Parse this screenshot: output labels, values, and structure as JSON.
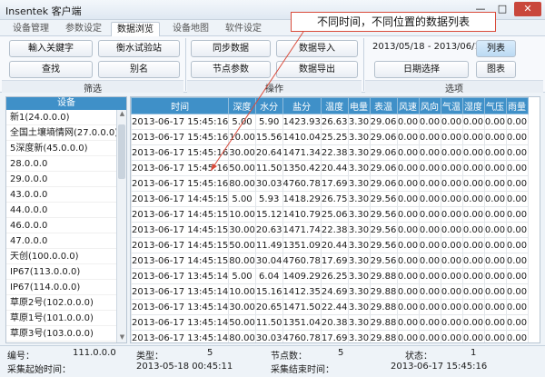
{
  "window": {
    "title": "Insentek 客户端",
    "min": "—",
    "max": "□",
    "close": "✕"
  },
  "tabs": [
    "设备管理",
    "参数设定",
    "数据浏览",
    "设备地图",
    "软件设定"
  ],
  "ribbon": {
    "filter": {
      "keyword_input": "輸入关鍵字",
      "site": "衡水试验站",
      "search": "查找",
      "alias": "别名",
      "label": "筛选"
    },
    "ops": {
      "sync": "同步数据",
      "import": "数据导入",
      "node_params": "节点参数",
      "export": "数据导出",
      "label": "操作"
    },
    "options": {
      "date_range": "2013/05/18 - 2013/06/17",
      "list": "列表",
      "date_select": "日期选择",
      "chart": "图表",
      "label": "选项"
    }
  },
  "device_panel": {
    "header": "设备",
    "items": [
      "新1(24.0.0.0)",
      "全国土壤墒情网(27.0.0.0)",
      "5深度新(45.0.0.0)",
      "28.0.0.0",
      "29.0.0.0",
      "43.0.0.0",
      "44.0.0.0",
      "46.0.0.0",
      "47.0.0.0",
      "天创(100.0.0.0)",
      "IP67(113.0.0.0)",
      "IP67(114.0.0.0)",
      "草原2号(102.0.0.0)",
      "草原1号(101.0.0.0)",
      "草原3号(103.0.0.0)"
    ]
  },
  "table": {
    "headers": [
      "时间",
      "深度",
      "水分",
      "盐分",
      "温度",
      "电量",
      "表温",
      "风速",
      "风向",
      "气温",
      "湿度",
      "气压",
      "雨量"
    ],
    "rows": [
      [
        "2013-06-17 15:45:16",
        "5.00",
        "5.90",
        "1423.93",
        "26.63",
        "3.30",
        "29.06",
        "0.00",
        "0.00",
        "0.00",
        "0.00",
        "0.00",
        "0.00"
      ],
      [
        "2013-06-17 15:45:16",
        "10.00",
        "15.56",
        "1410.04",
        "25.25",
        "3.30",
        "29.06",
        "0.00",
        "0.00",
        "0.00",
        "0.00",
        "0.00",
        "0.00"
      ],
      [
        "2013-06-17 15:45:16",
        "30.00",
        "20.64",
        "1471.34",
        "22.38",
        "3.30",
        "29.06",
        "0.00",
        "0.00",
        "0.00",
        "0.00",
        "0.00",
        "0.00"
      ],
      [
        "2013-06-17 15:45:16",
        "50.00",
        "11.50",
        "1350.42",
        "20.44",
        "3.30",
        "29.06",
        "0.00",
        "0.00",
        "0.00",
        "0.00",
        "0.00",
        "0.00"
      ],
      [
        "2013-06-17 15:45:16",
        "80.00",
        "30.03",
        "4760.78",
        "17.69",
        "3.30",
        "29.06",
        "0.00",
        "0.00",
        "0.00",
        "0.00",
        "0.00",
        "0.00"
      ],
      [
        "2013-06-17 14:45:15",
        "5.00",
        "5.93",
        "1418.29",
        "26.75",
        "3.30",
        "29.56",
        "0.00",
        "0.00",
        "0.00",
        "0.00",
        "0.00",
        "0.00"
      ],
      [
        "2013-06-17 14:45:15",
        "10.00",
        "15.12",
        "1410.79",
        "25.06",
        "3.30",
        "29.56",
        "0.00",
        "0.00",
        "0.00",
        "0.00",
        "0.00",
        "0.00"
      ],
      [
        "2013-06-17 14:45:15",
        "30.00",
        "20.63",
        "1471.74",
        "22.38",
        "3.30",
        "29.56",
        "0.00",
        "0.00",
        "0.00",
        "0.00",
        "0.00",
        "0.00"
      ],
      [
        "2013-06-17 14:45:15",
        "50.00",
        "11.49",
        "1351.09",
        "20.44",
        "3.30",
        "29.56",
        "0.00",
        "0.00",
        "0.00",
        "0.00",
        "0.00",
        "0.00"
      ],
      [
        "2013-06-17 14:45:15",
        "80.00",
        "30.04",
        "4760.78",
        "17.69",
        "3.30",
        "29.56",
        "0.00",
        "0.00",
        "0.00",
        "0.00",
        "0.00",
        "0.00"
      ],
      [
        "2013-06-17 13:45:14",
        "5.00",
        "6.04",
        "1409.29",
        "26.25",
        "3.30",
        "29.88",
        "0.00",
        "0.00",
        "0.00",
        "0.00",
        "0.00",
        "0.00"
      ],
      [
        "2013-06-17 13:45:14",
        "10.00",
        "15.16",
        "1412.35",
        "24.69",
        "3.30",
        "29.88",
        "0.00",
        "0.00",
        "0.00",
        "0.00",
        "0.00",
        "0.00"
      ],
      [
        "2013-06-17 13:45:14",
        "30.00",
        "20.65",
        "1471.50",
        "22.44",
        "3.30",
        "29.88",
        "0.00",
        "0.00",
        "0.00",
        "0.00",
        "0.00",
        "0.00"
      ],
      [
        "2013-06-17 13:45:14",
        "50.00",
        "11.50",
        "1351.04",
        "20.38",
        "3.30",
        "29.88",
        "0.00",
        "0.00",
        "0.00",
        "0.00",
        "0.00",
        "0.00"
      ],
      [
        "2013-06-17 13:45:14",
        "80.00",
        "30.03",
        "4760.78",
        "17.69",
        "3.30",
        "29.88",
        "0.00",
        "0.00",
        "0.00",
        "0.00",
        "0.00",
        "0.00"
      ]
    ]
  },
  "status": {
    "id_label": "编号：",
    "id_value": "111.0.0.0",
    "type_label": "类型：",
    "type_value": "5",
    "nodes_label": "节点数：",
    "nodes_value": "5",
    "state_label": "状态：",
    "state_value": "1",
    "start_label": "采集起始时间：",
    "start_value": "2013-05-18 00:45:11",
    "end_label": "采集结束时间：",
    "end_value": "2013-06-17 15:45:16"
  },
  "annotation": {
    "text": "不同时间，不同位置的数据列表"
  },
  "colors": {
    "header_blue": "#3f90c8",
    "annotation_red": "#d94a3a"
  }
}
